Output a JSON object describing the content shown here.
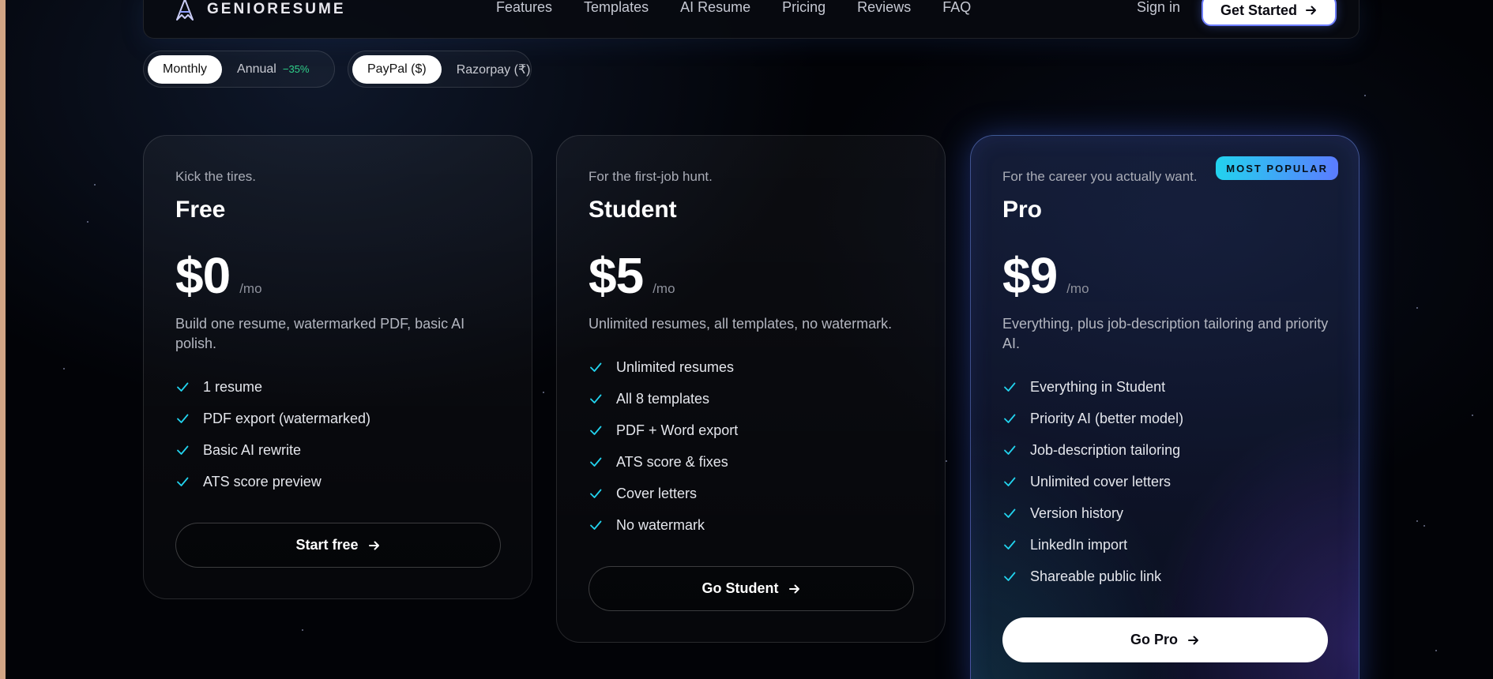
{
  "brand": {
    "name": "GENIORESUME"
  },
  "nav": {
    "links": [
      "Features",
      "Templates",
      "AI Resume",
      "Pricing",
      "Reviews",
      "FAQ"
    ],
    "sign_in": "Sign in",
    "cta": "Get Started"
  },
  "billing_toggle": {
    "options": [
      "Monthly",
      "Annual"
    ],
    "selected": "Monthly",
    "annual_discount": "−35%"
  },
  "currency_toggle": {
    "options": [
      "PayPal ($)",
      "Razorpay (₹)"
    ],
    "selected": "PayPal ($)"
  },
  "plans": [
    {
      "tagline": "Kick the tires.",
      "name": "Free",
      "price": "$0",
      "period": "/mo",
      "description": "Build one resume, watermarked PDF, basic AI polish.",
      "features": [
        "1 resume",
        "PDF export (watermarked)",
        "Basic AI rewrite",
        "ATS score preview"
      ],
      "button": "Start free"
    },
    {
      "tagline": "For the first-job hunt.",
      "name": "Student",
      "price": "$5",
      "period": "/mo",
      "description": "Unlimited resumes, all templates, no watermark.",
      "features": [
        "Unlimited resumes",
        "All 8 templates",
        "PDF + Word export",
        "ATS score & fixes",
        "Cover letters",
        "No watermark"
      ],
      "button": "Go Student"
    },
    {
      "badge": "MOST POPULAR",
      "tagline": "For the career you actually want.",
      "name": "Pro",
      "price": "$9",
      "period": "/mo",
      "description": "Everything, plus job-description tailoring and priority AI.",
      "features": [
        "Everything in Student",
        "Priority AI (better model)",
        "Job-description tailoring",
        "Unlimited cover letters",
        "Version history",
        "LinkedIn import",
        "Shareable public link"
      ],
      "button": "Go Pro"
    }
  ],
  "colors": {
    "accent_check": "#22d3ee",
    "discount": "#2fd08a",
    "badge_gradient": [
      "#22d3ee",
      "#5b7cff"
    ]
  }
}
